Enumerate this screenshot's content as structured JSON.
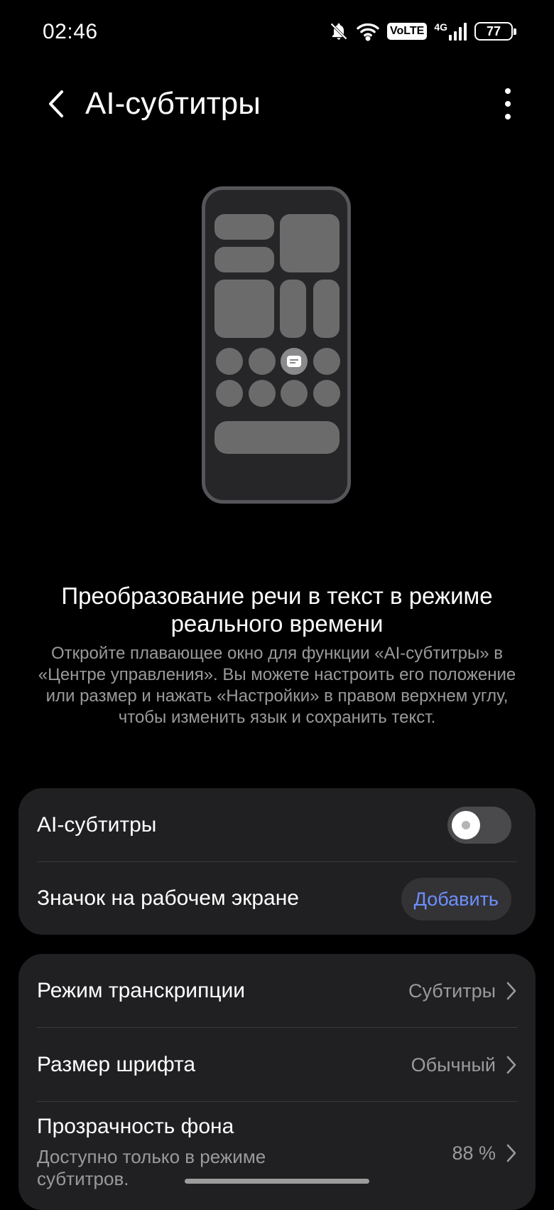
{
  "status_bar": {
    "time": "02:46",
    "volte": "VoLTE",
    "network": "4G",
    "battery": "77",
    "icons": [
      "bell-off-icon",
      "wifi-icon",
      "signal-icon"
    ]
  },
  "header": {
    "title": "AI-субтитры",
    "back_icon": "chevron-left-icon",
    "menu_icon": "more-vertical-icon"
  },
  "intro": {
    "heading": "Преобразование речи в текст в режиме реального времени",
    "description": "Откройте плавающее окно для функции «AI-субтитры» в «Центре управления». Вы можете настроить его положение или размер и нажать «Настройки» в правом верхнем углу, чтобы изменить язык и сохранить текст."
  },
  "card1": {
    "toggle_label": "AI-субтитры",
    "toggle_on": false,
    "shortcut_label": "Значок на рабочем экране",
    "shortcut_button": "Добавить"
  },
  "card2": {
    "items": [
      {
        "label": "Режим транскрипции",
        "value": "Субтитры"
      },
      {
        "label": "Размер шрифта",
        "value": "Обычный"
      },
      {
        "label": "Прозрачность фона",
        "sublabel": "Доступно только в режиме субтитров.",
        "value": "88 %"
      }
    ]
  },
  "colors": {
    "background": "#000000",
    "card": "#202022",
    "accent": "#6d8fff",
    "secondary_text": "#9a9a9a"
  }
}
